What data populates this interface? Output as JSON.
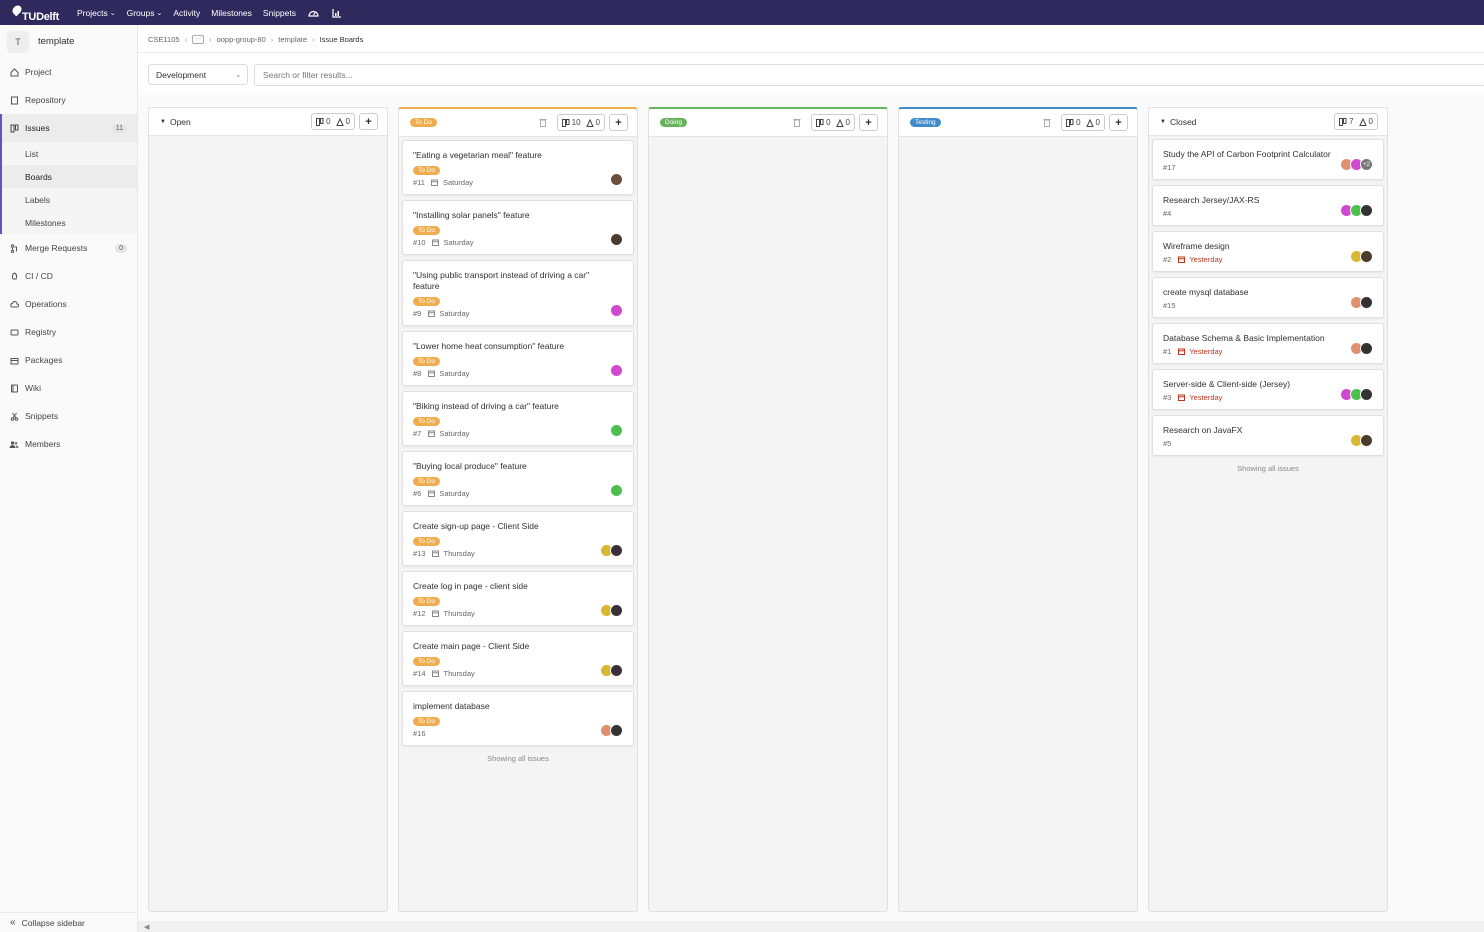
{
  "topnav": {
    "logo": "TUDelft",
    "items": [
      "Projects",
      "Groups",
      "Activity",
      "Milestones",
      "Snippets"
    ]
  },
  "sidebar": {
    "project_initial": "T",
    "project_name": "template",
    "items": [
      {
        "label": "Project",
        "icon": "home-icon"
      },
      {
        "label": "Repository",
        "icon": "doc-icon"
      },
      {
        "label": "Issues",
        "icon": "issues-icon",
        "count": "11"
      }
    ],
    "issues_sub": [
      "List",
      "Boards",
      "Labels",
      "Milestones"
    ],
    "items2": [
      {
        "label": "Merge Requests",
        "icon": "merge-icon",
        "count": "0"
      },
      {
        "label": "CI / CD",
        "icon": "rocket-icon"
      },
      {
        "label": "Operations",
        "icon": "cloud-icon"
      },
      {
        "label": "Registry",
        "icon": "disk-icon"
      },
      {
        "label": "Packages",
        "icon": "package-icon"
      },
      {
        "label": "Wiki",
        "icon": "book-icon"
      },
      {
        "label": "Snippets",
        "icon": "scissors-icon"
      },
      {
        "label": "Members",
        "icon": "users-icon"
      }
    ],
    "collapse": "Collapse sidebar"
  },
  "breadcrumb": [
    "CSE1105",
    "oopp-group-80",
    "template",
    "Issue Boards"
  ],
  "filter": {
    "board": "Development",
    "search_placeholder": "Search or filter results..."
  },
  "colors": {
    "todo": "#f0ad4e",
    "doing": "#69b25d",
    "testing": "#428bca",
    "overdue": "#c0341d"
  },
  "lists": {
    "open": {
      "title": "Open",
      "issues": "0",
      "weight": "0"
    },
    "todo": {
      "title": "To Do",
      "issues": "10",
      "weight": "0",
      "showing": "Showing all issues"
    },
    "doing": {
      "title": "Doing",
      "issues": "0",
      "weight": "0"
    },
    "testing": {
      "title": "Testing",
      "issues": "0",
      "weight": "0"
    },
    "closed": {
      "title": "Closed",
      "issues": "7",
      "weight": "0",
      "showing": "Showing all issues"
    }
  },
  "todo_cards": [
    {
      "title": "\"Eating a vegetarian meal\" feature",
      "label": "To Do",
      "num": "#11",
      "due": "Saturday"
    },
    {
      "title": "\"Installing solar panels\" feature",
      "label": "To Do",
      "num": "#10",
      "due": "Saturday"
    },
    {
      "title": "\"Using public transport instead of driving a car\" feature",
      "label": "To Do",
      "num": "#9",
      "due": "Saturday"
    },
    {
      "title": "\"Lower home heat consumption\" feature",
      "label": "To Do",
      "num": "#8",
      "due": "Saturday"
    },
    {
      "title": "\"Biking instead of driving a car\" feature",
      "label": "To Do",
      "num": "#7",
      "due": "Saturday"
    },
    {
      "title": "\"Buying local produce\" feature",
      "label": "To Do",
      "num": "#6",
      "due": "Saturday"
    },
    {
      "title": "Create sign-up page - Client Side",
      "label": "To Do",
      "num": "#13",
      "due": "Thursday"
    },
    {
      "title": "Create log in page - client side",
      "label": "To Do",
      "num": "#12",
      "due": "Thursday"
    },
    {
      "title": "Create main page - Client Side",
      "label": "To Do",
      "num": "#14",
      "due": "Thursday"
    },
    {
      "title": "implement database",
      "label": "To Do",
      "num": "#16",
      "due": ""
    }
  ],
  "closed_cards": [
    {
      "title": "Study the API of Carbon Footprint Calculator",
      "num": "#17",
      "due": "",
      "more": "+2"
    },
    {
      "title": "Research Jersey/JAX-RS",
      "num": "#4",
      "due": ""
    },
    {
      "title": "Wireframe design",
      "num": "#2",
      "due": "Yesterday"
    },
    {
      "title": "create mysql database",
      "num": "#15",
      "due": ""
    },
    {
      "title": "Database Schema & Basic Implementation",
      "num": "#1",
      "due": "Yesterday"
    },
    {
      "title": "Server-side & Client-side (Jersey)",
      "num": "#3",
      "due": "Yesterday"
    },
    {
      "title": "Research on JavaFX",
      "num": "#5",
      "due": ""
    }
  ]
}
